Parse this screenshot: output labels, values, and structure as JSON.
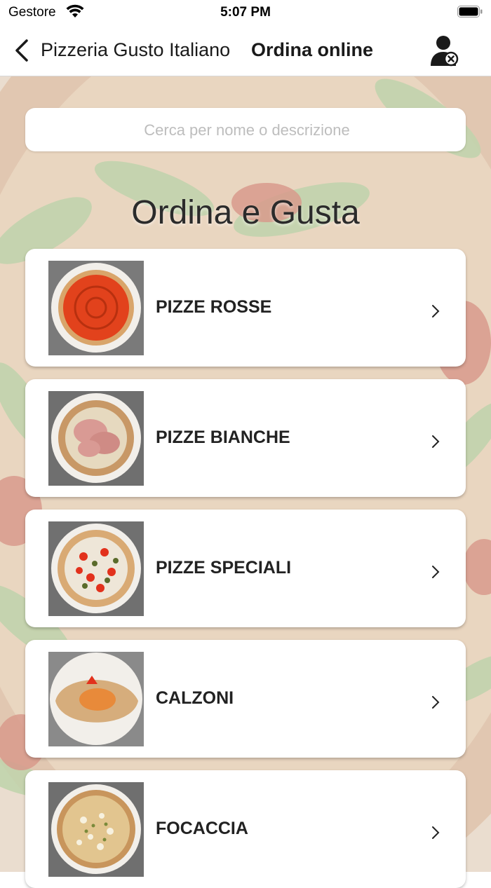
{
  "status_bar": {
    "carrier": "Gestore",
    "time": "5:07 PM"
  },
  "nav": {
    "restaurant": "Pizzeria Gusto Italiano",
    "title": "Ordina online"
  },
  "search": {
    "placeholder": "Cerca per nome o descrizione"
  },
  "heading": "Ordina e Gusta",
  "categories": [
    {
      "label": "PIZZE ROSSE"
    },
    {
      "label": "PIZZE BIANCHE"
    },
    {
      "label": "PIZZE SPECIALI"
    },
    {
      "label": "CALZONI"
    },
    {
      "label": "FOCACCIA"
    }
  ],
  "colors": {
    "background_tint": "#e9dccb",
    "text": "#222222"
  }
}
